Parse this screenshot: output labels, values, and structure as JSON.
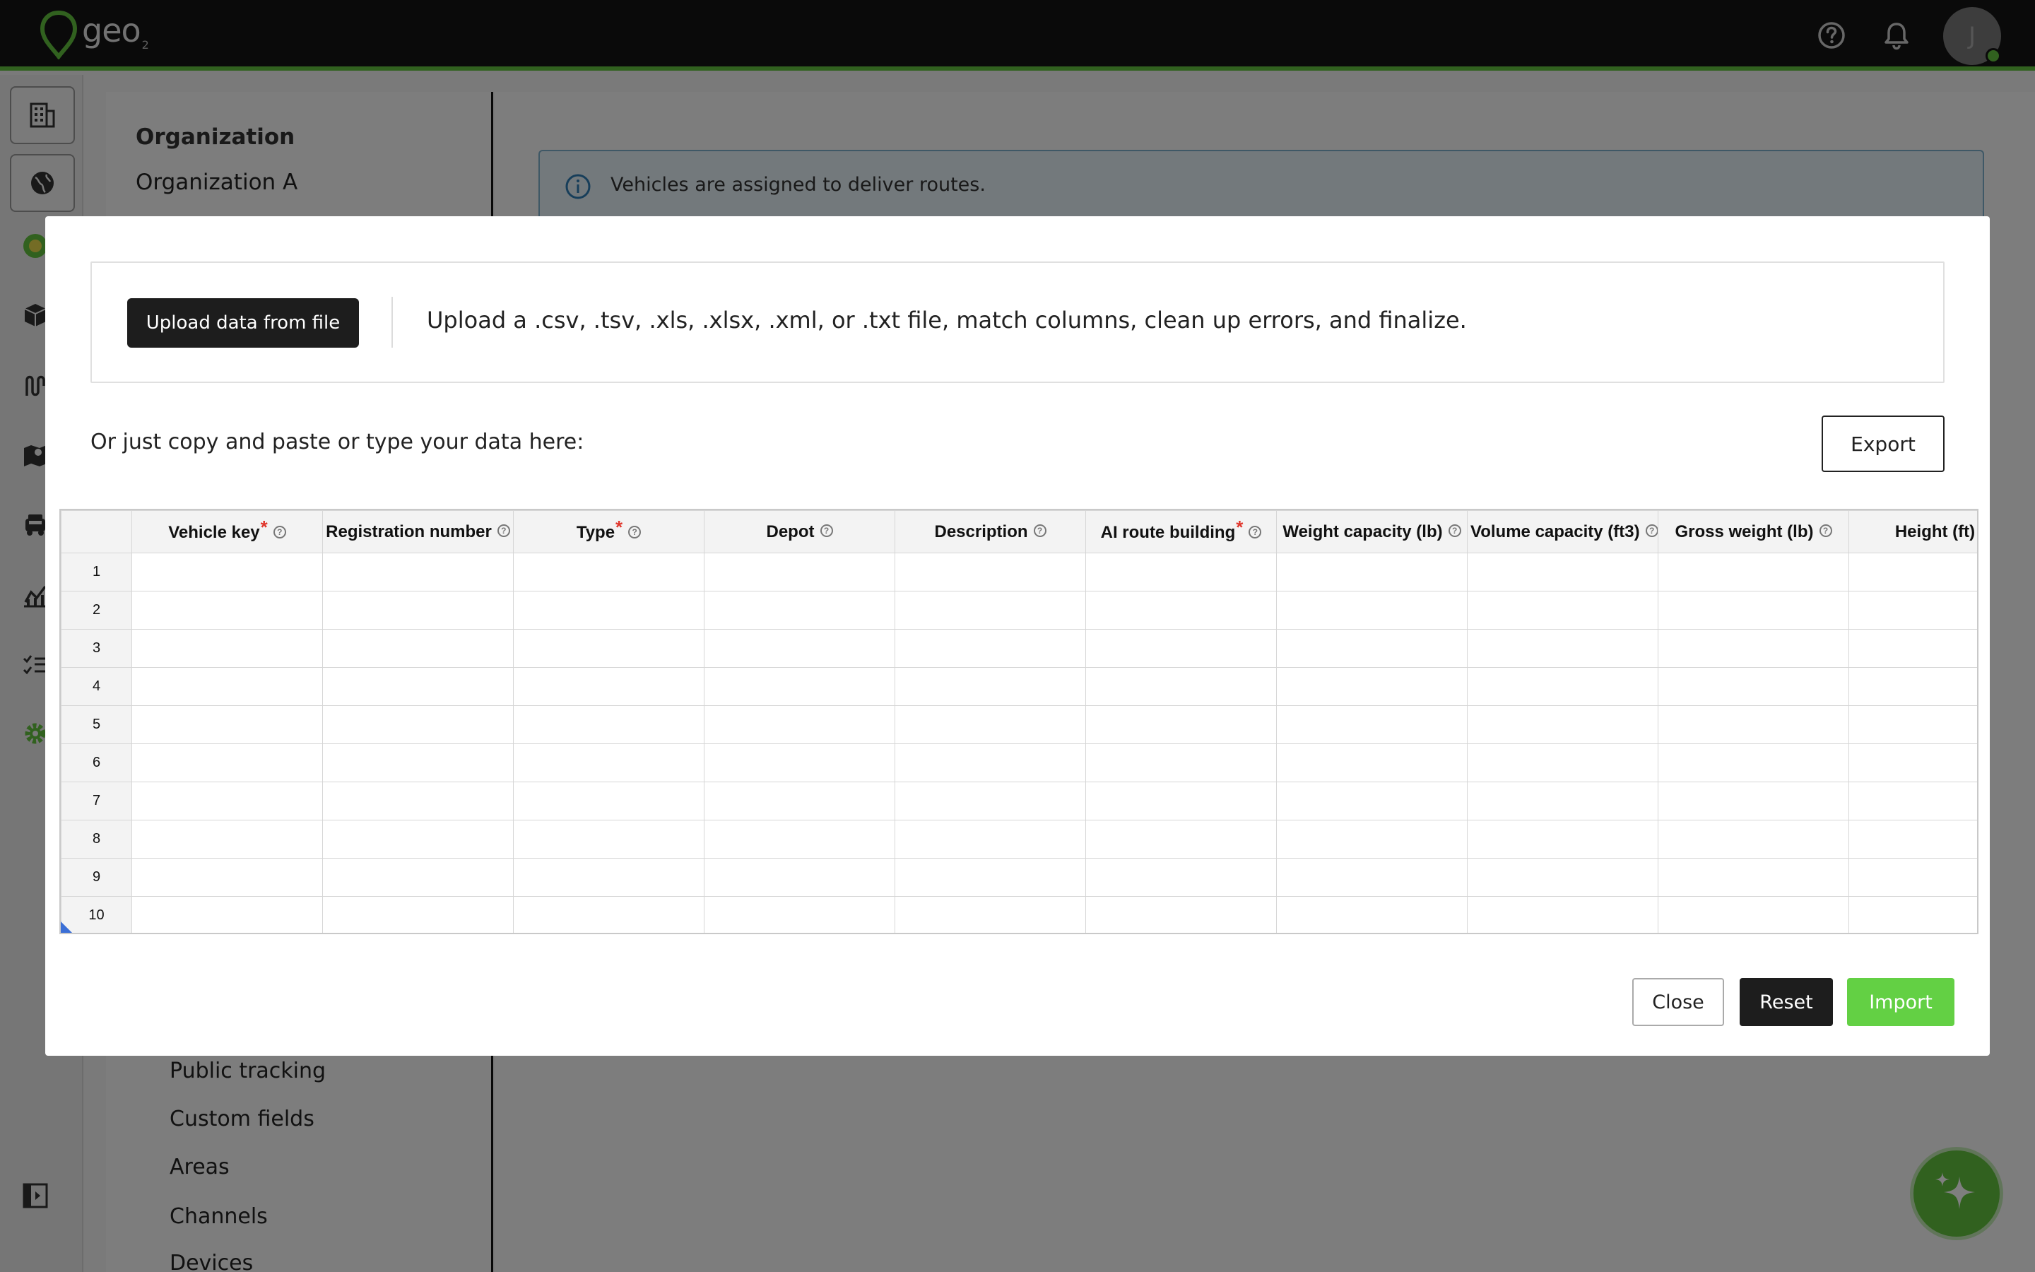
{
  "app": {
    "logo_text": "geo",
    "logo_sub": "2",
    "avatar_initial": "J"
  },
  "topbar": {
    "icons": [
      "help-icon",
      "bell-icon"
    ]
  },
  "rail": {
    "icons": [
      "building-icon",
      "globe-icon",
      "map-pin-icon",
      "box-icon",
      "route-icon",
      "map-icon",
      "truck-icon",
      "chart-icon",
      "checklist-icon",
      "gear-icon",
      "collapse-sidebar-icon"
    ]
  },
  "settings": {
    "org_label": "Organization",
    "org_name": "Organization A",
    "items": [
      "Public tracking",
      "Custom fields",
      "Areas",
      "Channels",
      "Devices"
    ]
  },
  "info": {
    "text": "Vehicles are assigned to deliver routes."
  },
  "modal": {
    "upload_button": "Upload data from file",
    "upload_description": "Upload a .csv, .tsv, .xls, .xlsx, .xml, or .txt file, match columns, clean up errors, and finalize.",
    "paste_label": "Or just copy and paste or type your data here:",
    "export_button": "Export",
    "columns": [
      {
        "label": "Vehicle key",
        "required": true
      },
      {
        "label": "Registration number",
        "required": false
      },
      {
        "label": "Type",
        "required": true
      },
      {
        "label": "Depot",
        "required": false
      },
      {
        "label": "Description",
        "required": false
      },
      {
        "label": "AI route building",
        "required": true
      },
      {
        "label": "Weight capacity (lb)",
        "required": false
      },
      {
        "label": "Volume capacity (ft3)",
        "required": false
      },
      {
        "label": "Gross weight (lb)",
        "required": false
      },
      {
        "label": "Height (ft)",
        "required": false
      }
    ],
    "rows": [
      "1",
      "2",
      "3",
      "4",
      "5",
      "6",
      "7",
      "8",
      "9",
      "10"
    ],
    "close_button": "Close",
    "reset_button": "Reset",
    "import_button": "Import"
  },
  "colors": {
    "accent": "#63c23f",
    "import": "#63d044",
    "required": "#e0362c",
    "info_border": "#7fb1cc"
  }
}
